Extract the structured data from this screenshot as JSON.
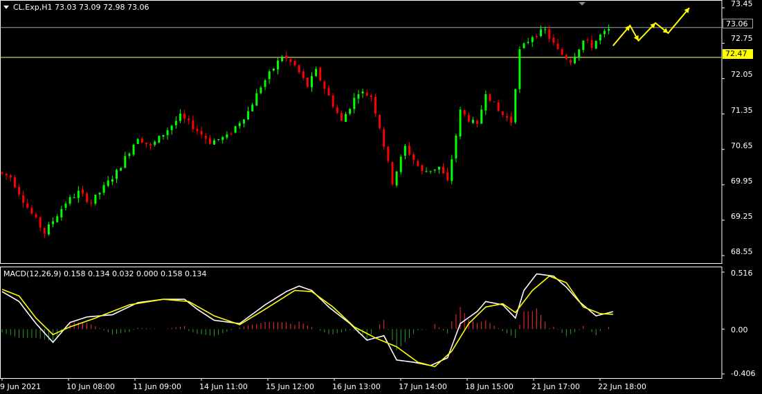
{
  "header": {
    "symbol_line": "CL.Exp,H1  73.03 73.09 72.98 73.06",
    "macd_line": "MACD(12,26,9) 0.158 0.134 0.032 0.000 0.158 0.134"
  },
  "price_axis": {
    "ticks": [
      "73.45",
      "72.75",
      "72.05",
      "71.35",
      "70.65",
      "69.95",
      "69.25",
      "68.55"
    ]
  },
  "macd_axis": {
    "ticks": [
      "0.516",
      "0.00",
      "-0.406"
    ]
  },
  "time_axis": {
    "ticks": [
      "9 Jun 2021",
      "10 Jun 08:00",
      "11 Jun 09:00",
      "14 Jun 11:00",
      "15 Jun 12:00",
      "16 Jun 13:00",
      "17 Jun 14:00",
      "18 Jun 15:00",
      "21 Jun 17:00",
      "22 Jun 18:00"
    ]
  },
  "levels": {
    "current": "73.06",
    "support": "72.47"
  },
  "colors": {
    "background": "#000000",
    "bull": "#00ff00",
    "bear": "#ff0000",
    "support_line": "#ffff66",
    "current_line": "#9aa7b0",
    "macd_main": "#ffffff",
    "macd_signal": "#ffff00",
    "hist_pos": "#ff3030",
    "hist_neg": "#2aa02a",
    "arrow": "#ffff00"
  },
  "chart_data": [
    {
      "type": "candlestick",
      "title": "CL.Exp,H1",
      "ylim": [
        68.4,
        73.55
      ],
      "x": [
        "9 Jun 2021",
        "10 Jun 08:00",
        "11 Jun 09:00",
        "14 Jun 11:00",
        "15 Jun 12:00",
        "16 Jun 13:00",
        "17 Jun 14:00",
        "18 Jun 15:00",
        "21 Jun 17:00",
        "22 Jun 18:00"
      ],
      "path": [
        [
          0,
          70.2
        ],
        [
          3,
          70.1
        ],
        [
          7,
          69.5
        ],
        [
          11,
          69.0
        ],
        [
          16,
          69.6
        ],
        [
          19,
          69.8
        ],
        [
          22,
          69.6
        ],
        [
          28,
          70.2
        ],
        [
          33,
          70.9
        ],
        [
          36,
          70.7
        ],
        [
          43,
          71.3
        ],
        [
          46,
          71.1
        ],
        [
          50,
          70.8
        ],
        [
          54,
          70.9
        ],
        [
          59,
          71.4
        ],
        [
          62,
          71.9
        ],
        [
          67,
          72.5
        ],
        [
          70,
          72.3
        ],
        [
          73,
          71.9
        ],
        [
          75,
          72.2
        ],
        [
          78,
          71.7
        ],
        [
          81,
          71.2
        ],
        [
          85,
          71.8
        ],
        [
          88,
          71.7
        ],
        [
          90,
          71.1
        ],
        [
          93,
          70.0
        ],
        [
          96,
          70.7
        ],
        [
          100,
          70.2
        ],
        [
          104,
          70.3
        ],
        [
          106,
          70.0
        ],
        [
          109,
          71.4
        ],
        [
          113,
          71.1
        ],
        [
          115,
          71.8
        ],
        [
          118,
          71.4
        ],
        [
          121,
          71.2
        ],
        [
          123,
          72.6
        ],
        [
          126,
          72.9
        ],
        [
          129,
          73.0
        ],
        [
          132,
          72.6
        ],
        [
          135,
          72.4
        ],
        [
          138,
          72.8
        ],
        [
          140,
          72.7
        ],
        [
          142,
          72.9
        ],
        [
          144,
          73.0
        ]
      ],
      "candle_count": 144,
      "annotations": [
        {
          "type": "arrow_path",
          "points": [
            [
              144,
              72.7
            ],
            [
              148,
              73.1
            ],
            [
              150,
              72.8
            ],
            [
              154,
              73.15
            ],
            [
              157,
              72.95
            ],
            [
              162,
              73.45
            ]
          ]
        }
      ]
    },
    {
      "type": "macd",
      "title": "MACD(12,26,9)",
      "params": [
        12,
        26,
        9
      ],
      "ylim": [
        -0.406,
        0.516
      ],
      "main": [
        [
          0,
          0.34
        ],
        [
          4,
          0.25
        ],
        [
          8,
          0.05
        ],
        [
          12,
          -0.12
        ],
        [
          16,
          0.06
        ],
        [
          20,
          0.11
        ],
        [
          26,
          0.13
        ],
        [
          32,
          0.24
        ],
        [
          38,
          0.27
        ],
        [
          43,
          0.27
        ],
        [
          46,
          0.18
        ],
        [
          50,
          0.08
        ],
        [
          56,
          0.05
        ],
        [
          62,
          0.22
        ],
        [
          67,
          0.34
        ],
        [
          70,
          0.39
        ],
        [
          73,
          0.35
        ],
        [
          77,
          0.2
        ],
        [
          82,
          0.05
        ],
        [
          86,
          -0.1
        ],
        [
          90,
          -0.06
        ],
        [
          93,
          -0.28
        ],
        [
          97,
          -0.3
        ],
        [
          101,
          -0.33
        ],
        [
          105,
          -0.26
        ],
        [
          108,
          0.05
        ],
        [
          112,
          0.16
        ],
        [
          114,
          0.25
        ],
        [
          118,
          0.22
        ],
        [
          121,
          0.1
        ],
        [
          123,
          0.35
        ],
        [
          126,
          0.5
        ],
        [
          130,
          0.48
        ],
        [
          133,
          0.38
        ],
        [
          136,
          0.25
        ],
        [
          140,
          0.12
        ],
        [
          144,
          0.158
        ]
      ],
      "signal": [
        [
          0,
          0.36
        ],
        [
          4,
          0.3
        ],
        [
          8,
          0.1
        ],
        [
          12,
          -0.05
        ],
        [
          16,
          0.02
        ],
        [
          22,
          0.1
        ],
        [
          30,
          0.22
        ],
        [
          38,
          0.27
        ],
        [
          44,
          0.25
        ],
        [
          50,
          0.12
        ],
        [
          56,
          0.04
        ],
        [
          62,
          0.18
        ],
        [
          69,
          0.35
        ],
        [
          73,
          0.34
        ],
        [
          78,
          0.2
        ],
        [
          83,
          0.02
        ],
        [
          88,
          -0.08
        ],
        [
          93,
          -0.16
        ],
        [
          98,
          -0.3
        ],
        [
          102,
          -0.34
        ],
        [
          106,
          -0.2
        ],
        [
          110,
          0.05
        ],
        [
          114,
          0.2
        ],
        [
          118,
          0.23
        ],
        [
          121,
          0.15
        ],
        [
          125,
          0.35
        ],
        [
          129,
          0.48
        ],
        [
          133,
          0.42
        ],
        [
          137,
          0.2
        ],
        [
          141,
          0.14
        ],
        [
          144,
          0.134
        ]
      ]
    }
  ]
}
